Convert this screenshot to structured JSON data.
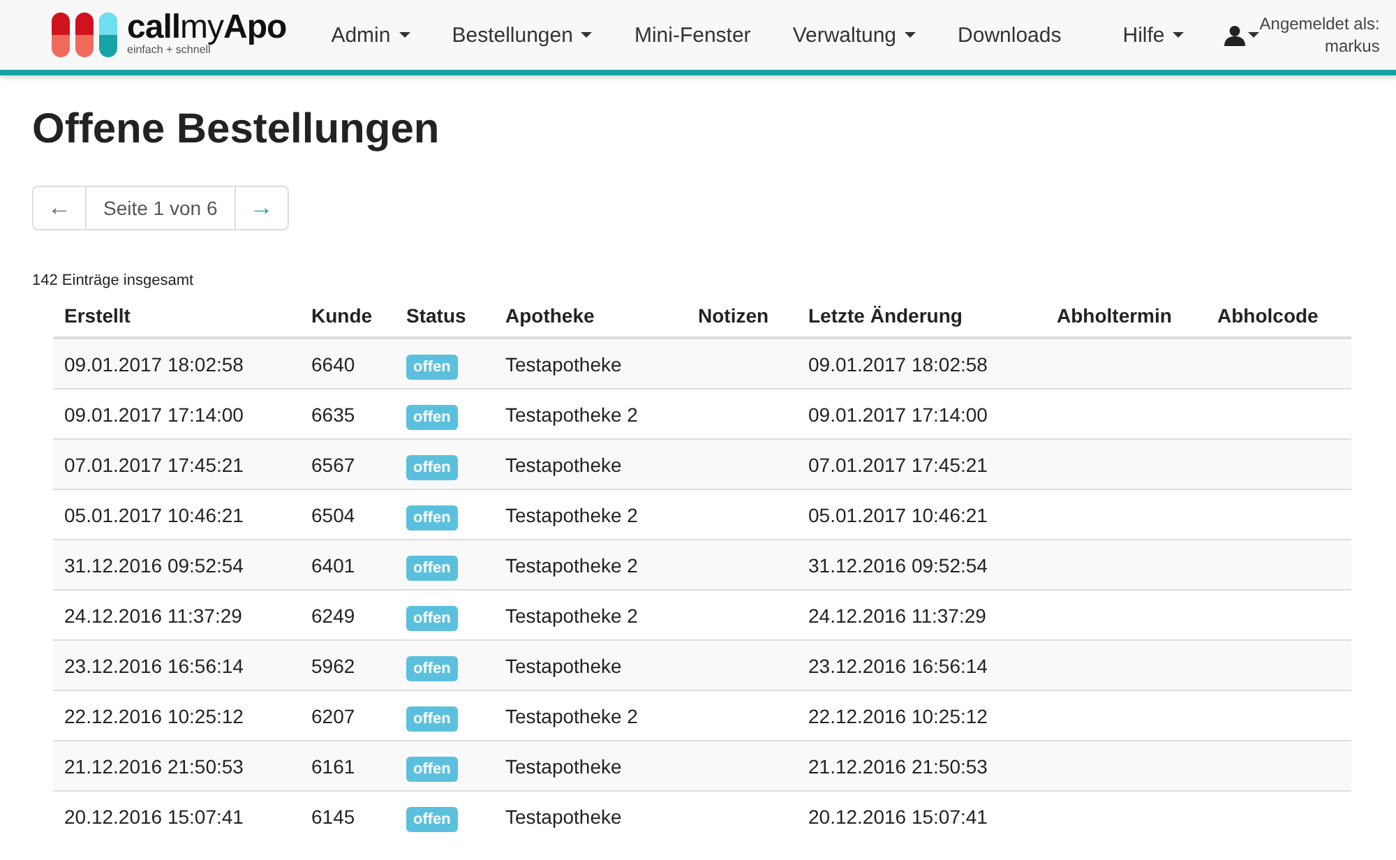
{
  "navbar": {
    "logo": {
      "wordmark": "**call**my**Apo**",
      "tagline": "einfach + schnell"
    },
    "menu": [
      {
        "label": "Admin",
        "dropdown": true
      },
      {
        "label": "Bestellungen",
        "dropdown": true
      },
      {
        "label": "Mini-Fenster",
        "dropdown": false
      },
      {
        "label": "Verwaltung",
        "dropdown": true
      },
      {
        "label": "Downloads",
        "dropdown": false
      },
      {
        "label": "Hilfe",
        "dropdown": true
      }
    ],
    "user": {
      "caption": "Angemeldet als:",
      "name": "markus"
    }
  },
  "title": "Offene Bestellungen",
  "pager": {
    "prev": {
      "label": "←",
      "disabled": true
    },
    "page": "Seite 1 von 6",
    "next": {
      "label": "→",
      "disabled": false
    }
  },
  "total": "142 Einträge insgesamt",
  "table": {
    "columns": [
      "Erstellt",
      "Kunde",
      "Status",
      "Apotheke",
      "Notizen",
      "Letzte Änderung",
      "Abholtermin",
      "Abholcode"
    ],
    "rows": [
      {
        "created": "09.01.2017 18:02:58",
        "customer": "6640",
        "status": "offen",
        "pharmacy": "Testapotheke",
        "changed": "09.01.2017 18:02:58"
      },
      {
        "created": "09.01.2017 17:14:00",
        "customer": "6635",
        "status": "offen",
        "pharmacy": "Testapotheke 2",
        "changed": "09.01.2017 17:14:00"
      },
      {
        "created": "07.01.2017 17:45:21",
        "customer": "6567",
        "status": "offen",
        "pharmacy": "Testapotheke",
        "changed": "07.01.2017 17:45:21"
      },
      {
        "created": "05.01.2017 10:46:21",
        "customer": "6504",
        "status": "offen",
        "pharmacy": "Testapotheke 2",
        "changed": "05.01.2017 10:46:21"
      },
      {
        "created": "31.12.2016 09:52:54",
        "customer": "6401",
        "status": "offen",
        "pharmacy": "Testapotheke 2",
        "changed": "31.12.2016 09:52:54"
      },
      {
        "created": "24.12.2016 11:37:29",
        "customer": "6249",
        "status": "offen",
        "pharmacy": "Testapotheke 2",
        "changed": "24.12.2016 11:37:29"
      },
      {
        "created": "23.12.2016 16:56:14",
        "customer": "5962",
        "status": "offen",
        "pharmacy": "Testapotheke",
        "changed": "23.12.2016 16:56:14"
      },
      {
        "created": "22.12.2016 10:25:12",
        "customer": "6207",
        "status": "offen",
        "pharmacy": "Testapotheke 2",
        "changed": "22.12.2016 10:25:12"
      },
      {
        "created": "21.12.2016 21:50:53",
        "customer": "6161",
        "status": "offen",
        "pharmacy": "Testapotheke",
        "changed": "21.12.2016 21:50:53"
      },
      {
        "created": "20.12.2016 15:07:41",
        "customer": "6145",
        "status": "offen",
        "pharmacy": "Testapotheke",
        "changed": "20.12.2016 15:07:41"
      }
    ]
  }
}
